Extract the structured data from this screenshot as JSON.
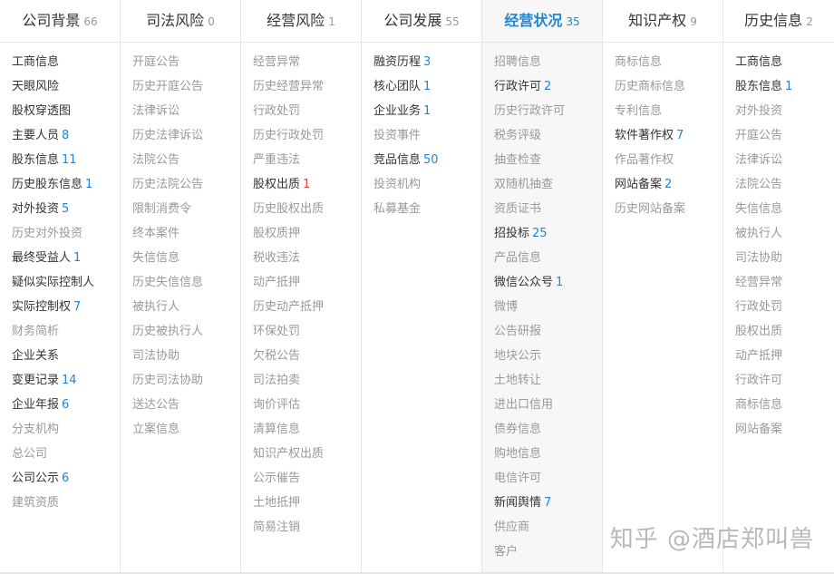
{
  "columns": [
    {
      "title": "公司背景",
      "count": "66",
      "active": false,
      "items": [
        {
          "label": "工商信息",
          "count": "",
          "state": "on"
        },
        {
          "label": "天眼风险",
          "count": "",
          "state": "on"
        },
        {
          "label": "股权穿透图",
          "count": "",
          "state": "on"
        },
        {
          "label": "主要人员",
          "count": "8",
          "state": "on"
        },
        {
          "label": "股东信息",
          "count": "11",
          "state": "on"
        },
        {
          "label": "历史股东信息",
          "count": "1",
          "state": "on"
        },
        {
          "label": "对外投资",
          "count": "5",
          "state": "on"
        },
        {
          "label": "历史对外投资",
          "count": "",
          "state": "off"
        },
        {
          "label": "最终受益人",
          "count": "1",
          "state": "on"
        },
        {
          "label": "疑似实际控制人",
          "count": "",
          "state": "on"
        },
        {
          "label": "实际控制权",
          "count": "7",
          "state": "on"
        },
        {
          "label": "财务简析",
          "count": "",
          "state": "off"
        },
        {
          "label": "企业关系",
          "count": "",
          "state": "on"
        },
        {
          "label": "变更记录",
          "count": "14",
          "state": "on"
        },
        {
          "label": "企业年报",
          "count": "6",
          "state": "on"
        },
        {
          "label": "分支机构",
          "count": "",
          "state": "off"
        },
        {
          "label": "总公司",
          "count": "",
          "state": "off"
        },
        {
          "label": "公司公示",
          "count": "6",
          "state": "on"
        },
        {
          "label": "建筑资质",
          "count": "",
          "state": "off"
        }
      ]
    },
    {
      "title": "司法风险",
      "count": "0",
      "active": false,
      "items": [
        {
          "label": "开庭公告",
          "count": "",
          "state": "off"
        },
        {
          "label": "历史开庭公告",
          "count": "",
          "state": "off"
        },
        {
          "label": "法律诉讼",
          "count": "",
          "state": "off"
        },
        {
          "label": "历史法律诉讼",
          "count": "",
          "state": "off"
        },
        {
          "label": "法院公告",
          "count": "",
          "state": "off"
        },
        {
          "label": "历史法院公告",
          "count": "",
          "state": "off"
        },
        {
          "label": "限制消费令",
          "count": "",
          "state": "off"
        },
        {
          "label": "终本案件",
          "count": "",
          "state": "off"
        },
        {
          "label": "失信信息",
          "count": "",
          "state": "off"
        },
        {
          "label": "历史失信信息",
          "count": "",
          "state": "off"
        },
        {
          "label": "被执行人",
          "count": "",
          "state": "off"
        },
        {
          "label": "历史被执行人",
          "count": "",
          "state": "off"
        },
        {
          "label": "司法协助",
          "count": "",
          "state": "off"
        },
        {
          "label": "历史司法协助",
          "count": "",
          "state": "off"
        },
        {
          "label": "送达公告",
          "count": "",
          "state": "off"
        },
        {
          "label": "立案信息",
          "count": "",
          "state": "off"
        }
      ]
    },
    {
      "title": "经营风险",
      "count": "1",
      "active": false,
      "items": [
        {
          "label": "经营异常",
          "count": "",
          "state": "off"
        },
        {
          "label": "历史经营异常",
          "count": "",
          "state": "off"
        },
        {
          "label": "行政处罚",
          "count": "",
          "state": "off"
        },
        {
          "label": "历史行政处罚",
          "count": "",
          "state": "off"
        },
        {
          "label": "严重违法",
          "count": "",
          "state": "off"
        },
        {
          "label": "股权出质",
          "count": "1",
          "state": "hot"
        },
        {
          "label": "历史股权出质",
          "count": "",
          "state": "off"
        },
        {
          "label": "股权质押",
          "count": "",
          "state": "off"
        },
        {
          "label": "税收违法",
          "count": "",
          "state": "off"
        },
        {
          "label": "动产抵押",
          "count": "",
          "state": "off"
        },
        {
          "label": "历史动产抵押",
          "count": "",
          "state": "off"
        },
        {
          "label": "环保处罚",
          "count": "",
          "state": "off"
        },
        {
          "label": "欠税公告",
          "count": "",
          "state": "off"
        },
        {
          "label": "司法拍卖",
          "count": "",
          "state": "off"
        },
        {
          "label": "询价评估",
          "count": "",
          "state": "off"
        },
        {
          "label": "清算信息",
          "count": "",
          "state": "off"
        },
        {
          "label": "知识产权出质",
          "count": "",
          "state": "off"
        },
        {
          "label": "公示催告",
          "count": "",
          "state": "off"
        },
        {
          "label": "土地抵押",
          "count": "",
          "state": "off"
        },
        {
          "label": "简易注销",
          "count": "",
          "state": "off"
        }
      ]
    },
    {
      "title": "公司发展",
      "count": "55",
      "active": false,
      "items": [
        {
          "label": "融资历程",
          "count": "3",
          "state": "on"
        },
        {
          "label": "核心团队",
          "count": "1",
          "state": "on"
        },
        {
          "label": "企业业务",
          "count": "1",
          "state": "on"
        },
        {
          "label": "投资事件",
          "count": "",
          "state": "off"
        },
        {
          "label": "竞品信息",
          "count": "50",
          "state": "on"
        },
        {
          "label": "投资机构",
          "count": "",
          "state": "off"
        },
        {
          "label": "私募基金",
          "count": "",
          "state": "off"
        }
      ]
    },
    {
      "title": "经营状况",
      "count": "35",
      "active": true,
      "items": [
        {
          "label": "招聘信息",
          "count": "",
          "state": "off"
        },
        {
          "label": "行政许可",
          "count": "2",
          "state": "on"
        },
        {
          "label": "历史行政许可",
          "count": "",
          "state": "off"
        },
        {
          "label": "税务评级",
          "count": "",
          "state": "off"
        },
        {
          "label": "抽查检查",
          "count": "",
          "state": "off"
        },
        {
          "label": "双随机抽查",
          "count": "",
          "state": "off"
        },
        {
          "label": "资质证书",
          "count": "",
          "state": "off"
        },
        {
          "label": "招投标",
          "count": "25",
          "state": "on"
        },
        {
          "label": "产品信息",
          "count": "",
          "state": "off"
        },
        {
          "label": "微信公众号",
          "count": "1",
          "state": "on"
        },
        {
          "label": "微博",
          "count": "",
          "state": "off"
        },
        {
          "label": "公告研报",
          "count": "",
          "state": "off"
        },
        {
          "label": "地块公示",
          "count": "",
          "state": "off"
        },
        {
          "label": "土地转让",
          "count": "",
          "state": "off"
        },
        {
          "label": "进出口信用",
          "count": "",
          "state": "off"
        },
        {
          "label": "债券信息",
          "count": "",
          "state": "off"
        },
        {
          "label": "购地信息",
          "count": "",
          "state": "off"
        },
        {
          "label": "电信许可",
          "count": "",
          "state": "off"
        },
        {
          "label": "新闻舆情",
          "count": "7",
          "state": "on"
        },
        {
          "label": "供应商",
          "count": "",
          "state": "off"
        },
        {
          "label": "客户",
          "count": "",
          "state": "off"
        }
      ]
    },
    {
      "title": "知识产权",
      "count": "9",
      "active": false,
      "items": [
        {
          "label": "商标信息",
          "count": "",
          "state": "off"
        },
        {
          "label": "历史商标信息",
          "count": "",
          "state": "off"
        },
        {
          "label": "专利信息",
          "count": "",
          "state": "off"
        },
        {
          "label": "软件著作权",
          "count": "7",
          "state": "on"
        },
        {
          "label": "作品著作权",
          "count": "",
          "state": "off"
        },
        {
          "label": "网站备案",
          "count": "2",
          "state": "on"
        },
        {
          "label": "历史网站备案",
          "count": "",
          "state": "off"
        }
      ]
    },
    {
      "title": "历史信息",
      "count": "2",
      "active": false,
      "items": [
        {
          "label": "工商信息",
          "count": "",
          "state": "on"
        },
        {
          "label": "股东信息",
          "count": "1",
          "state": "on"
        },
        {
          "label": "对外投资",
          "count": "",
          "state": "off"
        },
        {
          "label": "开庭公告",
          "count": "",
          "state": "off"
        },
        {
          "label": "法律诉讼",
          "count": "",
          "state": "off"
        },
        {
          "label": "法院公告",
          "count": "",
          "state": "off"
        },
        {
          "label": "失信信息",
          "count": "",
          "state": "off"
        },
        {
          "label": "被执行人",
          "count": "",
          "state": "off"
        },
        {
          "label": "司法协助",
          "count": "",
          "state": "off"
        },
        {
          "label": "经营异常",
          "count": "",
          "state": "off"
        },
        {
          "label": "行政处罚",
          "count": "",
          "state": "off"
        },
        {
          "label": "股权出质",
          "count": "",
          "state": "off"
        },
        {
          "label": "动产抵押",
          "count": "",
          "state": "off"
        },
        {
          "label": "行政许可",
          "count": "",
          "state": "off"
        },
        {
          "label": "商标信息",
          "count": "",
          "state": "off"
        },
        {
          "label": "网站备案",
          "count": "",
          "state": "off"
        }
      ]
    }
  ],
  "watermark": "知乎 @酒店郑叫兽",
  "colors": {
    "accent": "#1f86d6",
    "hot": "#e04a3a",
    "active_label": "#333333",
    "inactive_label": "#999999"
  }
}
